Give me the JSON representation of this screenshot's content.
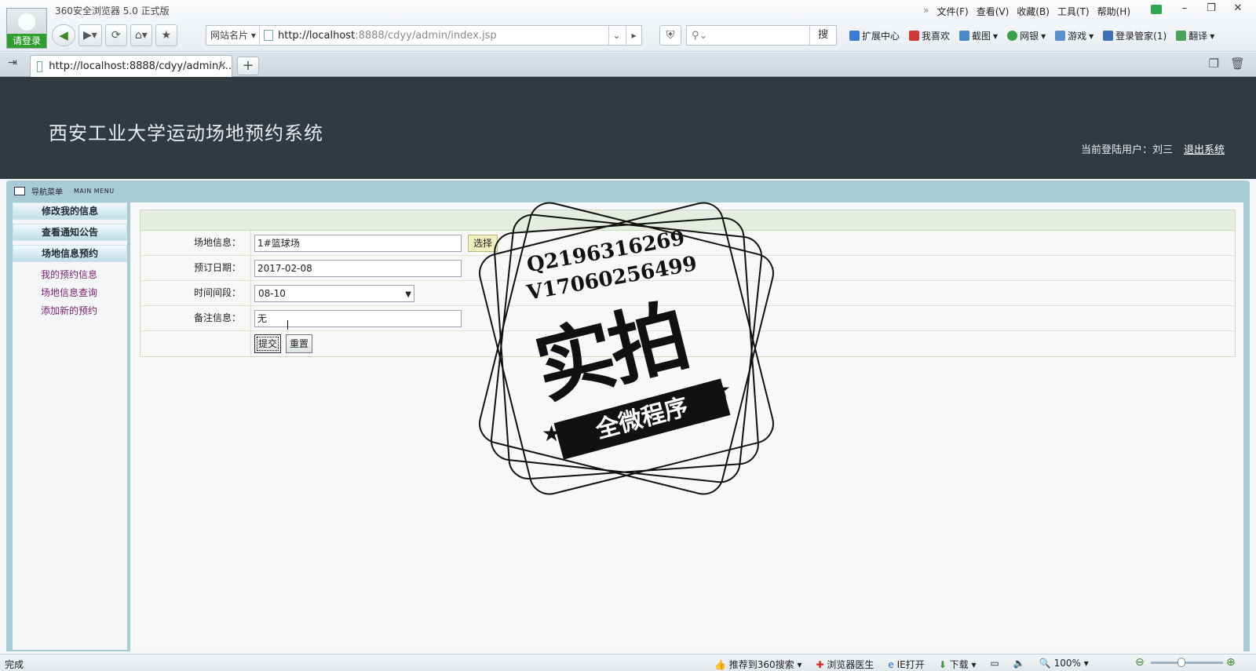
{
  "browser": {
    "app_title": "360安全浏览器 5.0 正式版",
    "login_label": "请登录",
    "menu": [
      "文件(F)",
      "查看(V)",
      "收藏(B)",
      "工具(T)",
      "帮助(H)"
    ],
    "site_card_label": "网站名片",
    "url_host": "http://localhost",
    "url_rest": ":8888/cdyy/admin/index.jsp",
    "search_button": "搜",
    "toolbar_items": [
      "扩展中心",
      "我喜欢",
      "截图",
      "网银",
      "游戏",
      "登录管家(1)",
      "翻译"
    ],
    "tab_title": "http://localhost:8888/cdyy/admin/...",
    "status_text": "完成",
    "status_items": [
      "推荐到360搜索",
      "浏览器医生",
      "IE打开",
      "下载"
    ],
    "zoom": "100%",
    "zoom_level": 0.42
  },
  "header": {
    "system_title": "西安工业大学运动场地预约系统",
    "current_user_label": "当前登陆用户：刘三",
    "logout_label": "退出系统"
  },
  "menu_header": {
    "label": "导航菜单",
    "label_en": "MAIN MENU"
  },
  "sidebar": {
    "items": [
      "修改我的信息",
      "查看通知公告",
      "场地信息预约"
    ],
    "subitems": [
      "我的预约信息",
      "场地信息查询",
      "添加新的预约"
    ]
  },
  "form": {
    "venue_label": "场地信息：",
    "venue_value": "1#篮球场",
    "select_button": "选择",
    "date_label": "预订日期：",
    "date_value": "2017-02-08",
    "time_label": "时间间段：",
    "time_value": "08-10",
    "remark_label": "备注信息：",
    "remark_value": "无",
    "submit_label": "提交",
    "reset_label": "重置"
  },
  "watermark": {
    "line1": "Q2196316269",
    "line2": "V17060256499",
    "big_text": "实拍",
    "ribbon_text": "全微程序"
  }
}
